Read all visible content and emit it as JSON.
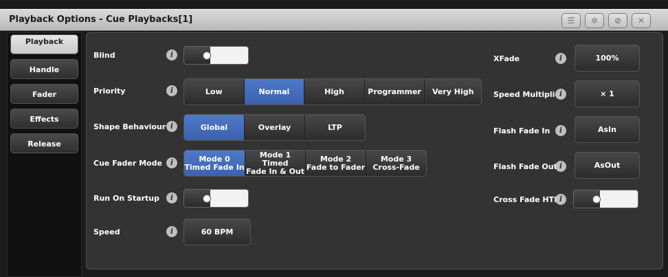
{
  "window": {
    "title": "Playback Options - Cue Playbacks[1]",
    "titlebar_icons": [
      "menu-icon",
      "gear-icon",
      "no-pin-icon",
      "close-icon"
    ]
  },
  "sidebar": {
    "items": [
      {
        "label": "Playback",
        "active": true
      },
      {
        "label": "Handle",
        "active": false
      },
      {
        "label": "Fader",
        "active": false
      },
      {
        "label": "Effects",
        "active": false
      },
      {
        "label": "Release",
        "active": false
      }
    ]
  },
  "left": {
    "blind": {
      "label": "Blind",
      "on": false
    },
    "priority": {
      "label": "Priority",
      "options": [
        "Low",
        "Normal",
        "High",
        "Programmer",
        "Very High"
      ],
      "selected": "Normal"
    },
    "shape": {
      "label": "Shape Behaviour",
      "options": [
        "Global",
        "Overlay",
        "LTP"
      ],
      "selected": "Global"
    },
    "cue_fader": {
      "label": "Cue Fader Mode",
      "options": [
        {
          "line1": "Mode 0",
          "line2": "Timed Fade In"
        },
        {
          "line1": "Mode 1 Timed",
          "line2": "Fade In & Out"
        },
        {
          "line1": "Mode 2",
          "line2": "Fade to Fader"
        },
        {
          "line1": "Mode 3",
          "line2": "Cross-Fade"
        }
      ],
      "selected": 0
    },
    "run_on_startup": {
      "label": "Run On Startup",
      "on": false
    },
    "speed": {
      "label": "Speed",
      "value": "60 BPM"
    }
  },
  "right": {
    "xfade": {
      "label": "XFade",
      "value": "100%"
    },
    "speed_multiplier": {
      "label": "Speed Multiplier",
      "value": "× 1"
    },
    "flash_fade_in": {
      "label": "Flash Fade In",
      "value": "AsIn"
    },
    "flash_fade_out": {
      "label": "Flash Fade Out",
      "value": "AsOut"
    },
    "cross_fade_htp": {
      "label": "Cross Fade HTP",
      "on": false
    }
  },
  "colors": {
    "selected": "#4a72c2",
    "panel": "#333333",
    "titlebar": "#cfcfcf"
  }
}
